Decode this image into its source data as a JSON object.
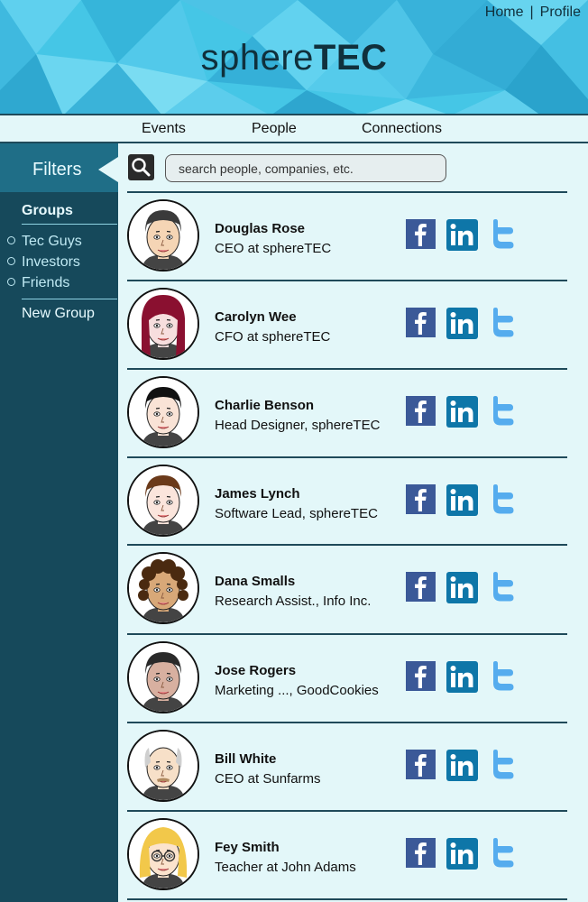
{
  "header": {
    "brand_light": "sphere",
    "brand_bold": "TEC",
    "home_link": "Home",
    "separator": "|",
    "profile_link": "Profile"
  },
  "nav": {
    "tabs": [
      {
        "label": "Events"
      },
      {
        "label": "People"
      },
      {
        "label": "Connections"
      }
    ]
  },
  "sidebar": {
    "filters_label": "Filters",
    "groups_title": "Groups",
    "groups": [
      {
        "label": "Tec Guys"
      },
      {
        "label": "Investors"
      },
      {
        "label": "Friends"
      }
    ],
    "new_group": "New Group"
  },
  "search": {
    "placeholder": "search people, companies, etc.",
    "value": ""
  },
  "people": [
    {
      "name": "Douglas Rose",
      "title": "CEO at sphereTEC"
    },
    {
      "name": "Carolyn Wee",
      "title": "CFO at sphereTEC"
    },
    {
      "name": "Charlie Benson",
      "title": "Head Designer, sphereTEC"
    },
    {
      "name": "James Lynch",
      "title": "Software Lead, sphereTEC"
    },
    {
      "name": "Dana Smalls",
      "title": "Research Assist., Info Inc."
    },
    {
      "name": "Jose Rogers",
      "title": "Marketing ..., GoodCookies"
    },
    {
      "name": "Bill White",
      "title": "CEO at Sunfarms"
    },
    {
      "name": "Fey Smith",
      "title": "Teacher at John Adams"
    }
  ],
  "social_icons": [
    "facebook-icon",
    "linkedin-icon",
    "twitter-icon"
  ],
  "colors": {
    "header_bg": "#45c6e6",
    "sidebar_bg": "#16495b",
    "filters_bg": "#1f6e87",
    "page_bg": "#e3f7f9",
    "facebook": "#3b5998",
    "linkedin": "#0e76a8",
    "twitter": "#55acee"
  }
}
